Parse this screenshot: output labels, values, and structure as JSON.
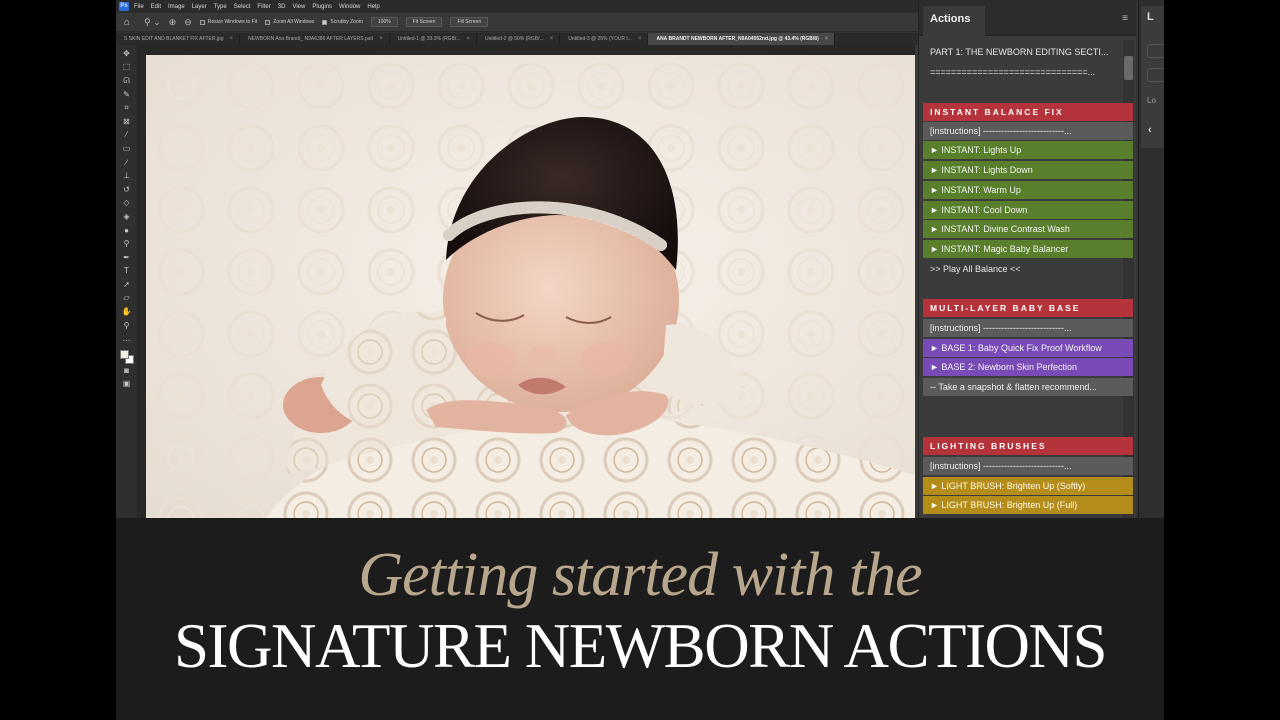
{
  "menubar": {
    "logo": "Ps",
    "items": [
      "File",
      "Edit",
      "Image",
      "Layer",
      "Type",
      "Select",
      "Filter",
      "3D",
      "View",
      "Plugins",
      "Window",
      "Help"
    ]
  },
  "options_bar": {
    "resize_windows_label": "Resize Windows to Fit",
    "zoom_all_label": "Zoom All Windows",
    "scrubby_zoom_label": "Scrubby Zoom",
    "zoom_value": "100%",
    "fit_screen_label": "Fit Screen",
    "fill_screen_label": "Fill Screen"
  },
  "doc_tabs": [
    {
      "label": "S SKIN EDIT AND BLANKET FIX AFTER.jpg",
      "active": false
    },
    {
      "label": "NEWBORN Ana Brandt_ N9A6386 AFTER LAYERS.psd",
      "active": false
    },
    {
      "label": "Untitled-1 @ 33.3% (RGB/...",
      "active": false
    },
    {
      "label": "Untitled-2 @ 50% (RGB/...",
      "active": false
    },
    {
      "label": "Untitled-3 @ 25% (YOUR I...",
      "active": false
    },
    {
      "label": "ANA BRANDT NEWBORN AFTER_N9A04052nd.jpg @ 43.4% (RGB/8)",
      "active": true
    }
  ],
  "actions_panel": {
    "tab_label": "Actions",
    "rows": [
      {
        "label": "PART 1: THE NEWBORN EDITING SECTI...",
        "style": "txt"
      },
      {
        "label": "==============================...",
        "style": "txt"
      },
      {
        "label": "INSTANT BALANCE FIX",
        "style": "red"
      },
      {
        "label": "[instructions]  ---------------------------...",
        "style": "gray"
      },
      {
        "label": "► INSTANT: Lights Up",
        "style": "green"
      },
      {
        "label": "► INSTANT: Lights Down",
        "style": "green"
      },
      {
        "label": "► INSTANT: Warm Up",
        "style": "green"
      },
      {
        "label": "► INSTANT: Cool Down",
        "style": "green"
      },
      {
        "label": "► INSTANT: Divine Contrast Wash",
        "style": "green"
      },
      {
        "label": "► INSTANT: Magic Baby Balancer",
        "style": "green"
      },
      {
        "label": ">> Play All Balance <<",
        "style": "txt"
      },
      {
        "label": "MULTI-LAYER BABY BASE",
        "style": "red"
      },
      {
        "label": "[instructions]  ---------------------------...",
        "style": "gray"
      },
      {
        "label": "► BASE 1: Baby Quick Fix Proof Workflow",
        "style": "purple"
      },
      {
        "label": "► BASE 2: Newborn Skin Perfection",
        "style": "purple"
      },
      {
        "label": "-- Take a snapshot & flatten recommend...",
        "style": "gray"
      },
      {
        "label": "LIGHTING BRUSHES",
        "style": "red"
      },
      {
        "label": "[instructions]  ---------------------------...",
        "style": "gray"
      },
      {
        "label": "► LIGHT BRUSH: Brighten Up (Softly)",
        "style": "yellow"
      },
      {
        "label": "► LIGHT BRUSH: Brighten Up (Full)",
        "style": "yellow"
      }
    ]
  },
  "side_panel": {
    "tab_initial": "L",
    "lo_label": "Lo"
  },
  "title": {
    "line1": "Getting started with the",
    "line2": "SIGNATURE NEWBORN ACTIONS"
  },
  "colors": {
    "red_header": "#b5343b",
    "green_action": "#5a7f2c",
    "purple_action": "#7a4bb6",
    "yellow_action": "#b48c1a",
    "title_gold": "#b8a78c"
  }
}
